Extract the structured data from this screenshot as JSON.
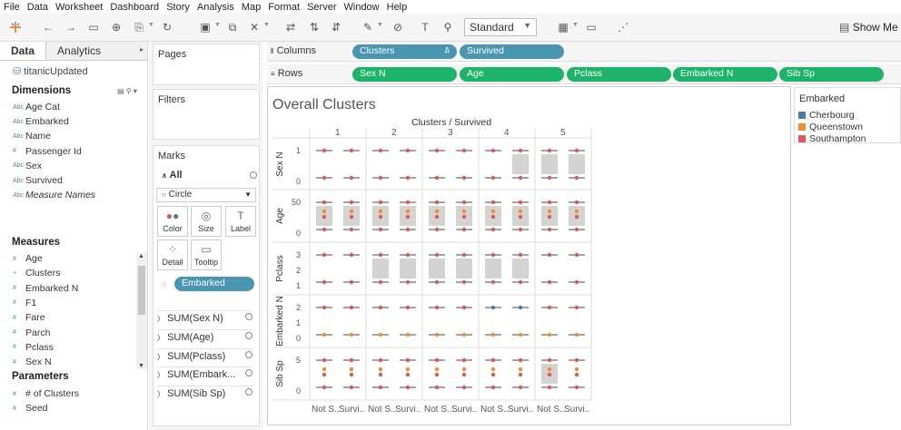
{
  "menu": [
    "File",
    "Data",
    "Worksheet",
    "Dashboard",
    "Story",
    "Analysis",
    "Map",
    "Format",
    "Server",
    "Window",
    "Help"
  ],
  "toolbar": {
    "fit_select": "Standard",
    "show_me": "Show Me"
  },
  "left_pane": {
    "tab_data": "Data",
    "tab_analytics": "Analytics",
    "datasource": "titanicUpdated",
    "dimensions_title": "Dimensions",
    "dimensions": [
      {
        "label": "Age Cat",
        "icon": "Abc"
      },
      {
        "label": "Embarked",
        "icon": "Abc"
      },
      {
        "label": "Name",
        "icon": "Abc"
      },
      {
        "label": "Passenger Id",
        "icon": "#"
      },
      {
        "label": "Sex",
        "icon": "Abc"
      },
      {
        "label": "Survived",
        "icon": "Abc"
      },
      {
        "label": "Measure Names",
        "icon": "Abc"
      }
    ],
    "measures_title": "Measures",
    "measures": [
      {
        "label": "Age",
        "icon": "#"
      },
      {
        "label": "Clusters",
        "icon": "+"
      },
      {
        "label": "Embarked N",
        "icon": "#"
      },
      {
        "label": "F1",
        "icon": "#"
      },
      {
        "label": "Fare",
        "icon": "#"
      },
      {
        "label": "Parch",
        "icon": "#"
      },
      {
        "label": "Pclass",
        "icon": "#"
      },
      {
        "label": "Sex N",
        "icon": "#"
      }
    ],
    "parameters_title": "Parameters",
    "parameters": [
      {
        "label": "# of Clusters",
        "icon": "#"
      },
      {
        "label": "Seed",
        "icon": "#"
      }
    ]
  },
  "cards": {
    "pages": "Pages",
    "filters": "Filters",
    "marks": "Marks",
    "marks_all": "All",
    "mark_type": "Circle",
    "buttons": [
      "Color",
      "Size",
      "Label",
      "Detail",
      "Tooltip"
    ],
    "color_pill": "Embarked",
    "measure_rows": [
      "SUM(Sex N)",
      "SUM(Age)",
      "SUM(Pclass)",
      "SUM(Embark...",
      "SUM(Sib Sp)"
    ]
  },
  "shelves": {
    "columns_label": "Columns",
    "columns": [
      "Clusters",
      "Survived"
    ],
    "rows_label": "Rows",
    "rows": [
      "Sex N",
      "Age",
      "Pclass",
      "Embarked N",
      "Sib Sp"
    ]
  },
  "viz": {
    "title": "Overall Clusters",
    "header": "Clusters / Survived",
    "clusters": [
      "1",
      "2",
      "3",
      "4",
      "5"
    ],
    "row_labels": [
      "Sex N",
      "Age",
      "Pclass",
      "Embarked N",
      "Sib Sp"
    ],
    "x_labels": [
      "Not S..",
      "Survi.."
    ],
    "y_ticks": [
      [
        "1",
        "0"
      ],
      [
        "50",
        "0"
      ],
      [
        "3",
        "2",
        "1"
      ],
      [
        "2",
        "1",
        "0"
      ],
      [
        "5",
        "0"
      ]
    ],
    "colors": {
      "cherbourg": "#4e79a7",
      "queenstown": "#f28e2b",
      "southampton": "#e15759"
    }
  },
  "legend": {
    "title": "Embarked",
    "items": [
      {
        "label": "Cherbourg",
        "color": "#4e79a7"
      },
      {
        "label": "Queenstown",
        "color": "#f28e2b"
      },
      {
        "label": "Southampton",
        "color": "#e15759"
      }
    ]
  }
}
